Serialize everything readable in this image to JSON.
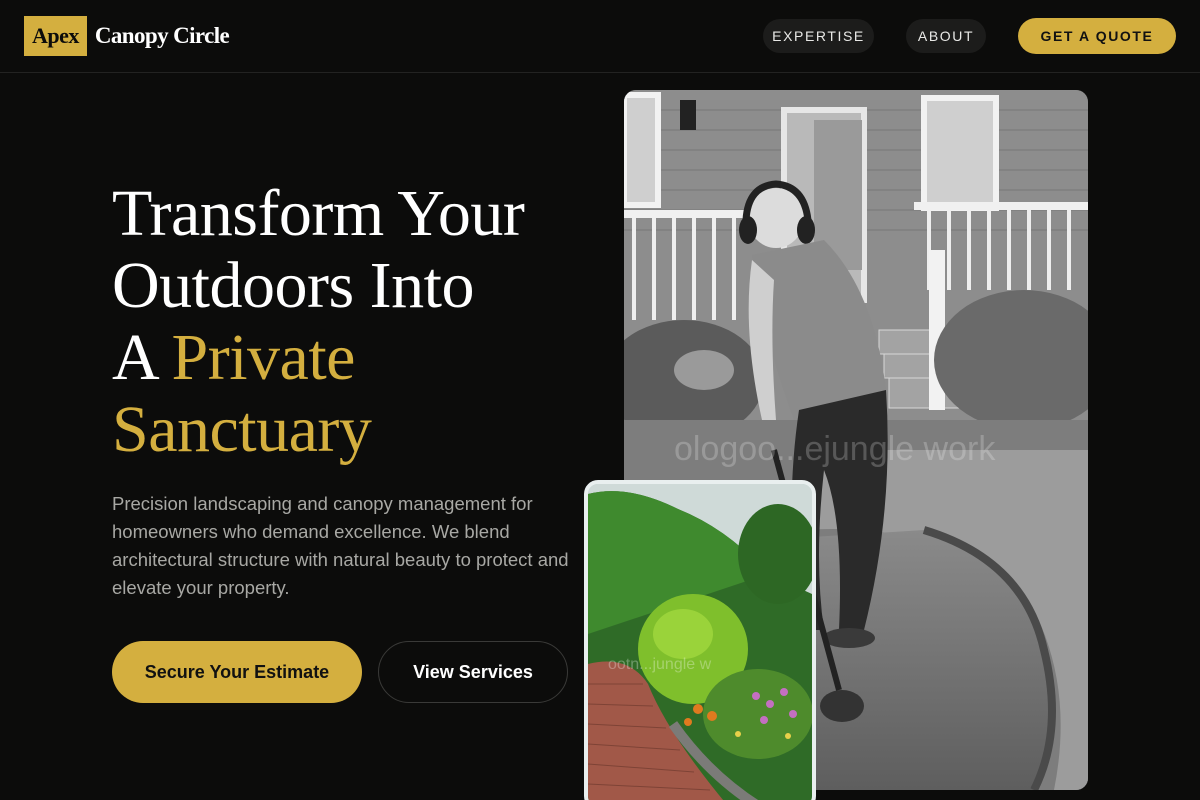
{
  "header": {
    "logo_mark": "Apex",
    "logo_text": "Canopy Circle",
    "nav": [
      {
        "label": "EXPERTISE"
      },
      {
        "label": "ABOUT"
      }
    ],
    "cta_label": "GET A QUOTE"
  },
  "hero": {
    "headline_line1": "Transform Your",
    "headline_line2": "Outdoors Into",
    "headline_line3_plain": "A ",
    "headline_line3_accent": "Private",
    "headline_line4_accent": "Sanctuary",
    "description": "Precision landscaping and canopy management for homeowners who demand excellence. We blend architectural structure with natural beauty to protect and elevate your property.",
    "primary_button": "Secure Your Estimate",
    "secondary_button": "View Services"
  },
  "images": {
    "main_photo": "landscaper-with-trimmer-photo",
    "inset_photo": "garden-path-photo"
  },
  "colors": {
    "background": "#0c0c0b",
    "accent": "#d4af3f",
    "muted_text": "#a8a8a4"
  }
}
